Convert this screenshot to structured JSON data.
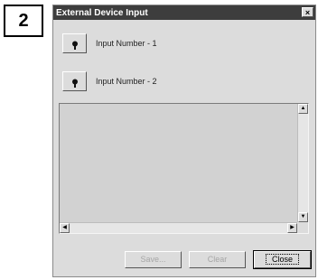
{
  "step_badge": "2",
  "dialog": {
    "title": "External Device Input",
    "close_glyph": "×"
  },
  "inputs": [
    {
      "label": "Input Number - 1",
      "icon": "plug-icon"
    },
    {
      "label": "Input Number - 2",
      "icon": "plug-icon"
    }
  ],
  "scrollbar": {
    "up": "▲",
    "down": "▼",
    "left": "◀",
    "right": "▶"
  },
  "buttons": {
    "save": "Save...",
    "clear": "Clear",
    "close": "Close"
  }
}
